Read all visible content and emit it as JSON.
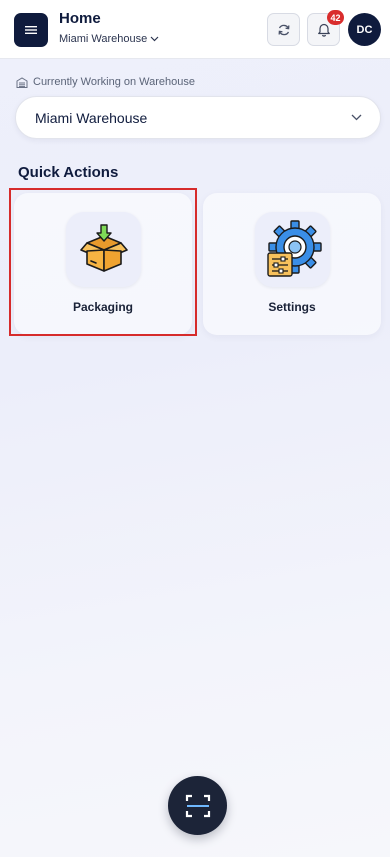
{
  "header": {
    "title": "Home",
    "warehouse": "Miami Warehouse",
    "notifications_count": "42",
    "avatar_initials": "DC"
  },
  "warehouse_section": {
    "label": "Currently Working on Warehouse",
    "selected": "Miami Warehouse"
  },
  "quick_actions": {
    "title": "Quick Actions",
    "items": [
      {
        "label": "Packaging",
        "icon": "open-box-icon",
        "selected": true
      },
      {
        "label": "Settings",
        "icon": "gear-settings-icon",
        "selected": false
      }
    ]
  },
  "fab": {
    "icon": "scan-icon"
  },
  "colors": {
    "navy": "#0f1b3d",
    "badge_red": "#d92d2d",
    "selection_red": "#d62b2b",
    "settings_blue": "#3a8ee6",
    "box_orange": "#f5b342"
  }
}
